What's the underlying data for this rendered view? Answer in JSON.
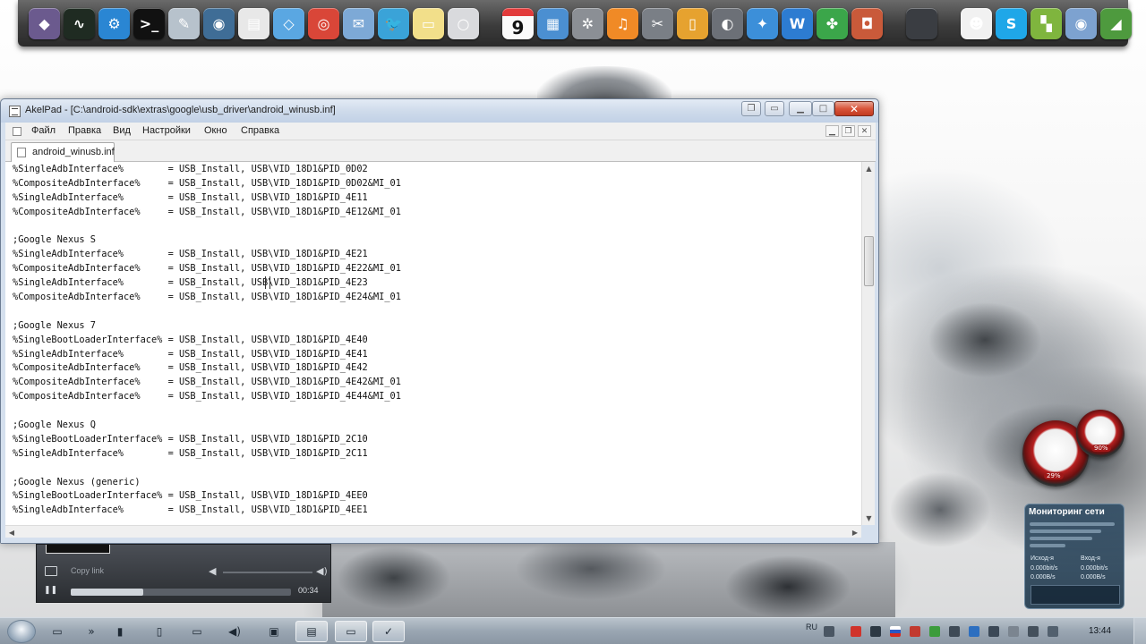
{
  "desktop": {
    "dock_icons": [
      {
        "name": "launchpad-icon",
        "glyph": "◆",
        "color": "#6b5a8e"
      },
      {
        "name": "activity-monitor-icon",
        "glyph": "∿",
        "color": "#1f2b22"
      },
      {
        "name": "system-preferences-icon",
        "glyph": "⚙",
        "color": "#2a86d3"
      },
      {
        "name": "terminal-icon",
        "glyph": ">_",
        "color": "#111111"
      },
      {
        "name": "textedit-icon",
        "glyph": "✎",
        "color": "#b7c2cc"
      },
      {
        "name": "disk-utility-icon",
        "glyph": "◉",
        "color": "#3f6d96"
      },
      {
        "name": "notepad-icon",
        "glyph": "▤",
        "color": "#e8e8e8"
      },
      {
        "name": "dropbox-icon",
        "glyph": "◇",
        "color": "#5aa7e2"
      },
      {
        "name": "chrome-icon",
        "glyph": "◎",
        "color": "#d94638"
      },
      {
        "name": "mail-icon",
        "glyph": "✉",
        "color": "#7da9d6"
      },
      {
        "name": "twitter-icon",
        "glyph": "🐦",
        "color": "#3aa3d8"
      },
      {
        "name": "notes-icon",
        "glyph": "▭",
        "color": "#f2df8a"
      },
      {
        "name": "finder-icon",
        "glyph": "○",
        "color": "#d9dadd"
      },
      {
        "name": "calendar-icon",
        "glyph": "9",
        "color": "#ffffff"
      },
      {
        "name": "preview-icon",
        "glyph": "▦",
        "color": "#4b8fd1"
      },
      {
        "name": "network-icon",
        "glyph": "✲",
        "color": "#8b8f95"
      },
      {
        "name": "itunes-icon",
        "glyph": "♫",
        "color": "#f08a26"
      },
      {
        "name": "photo-tool-icon",
        "glyph": "✂",
        "color": "#7a7f86"
      },
      {
        "name": "ibooks-icon",
        "glyph": "▯",
        "color": "#e6a22f"
      },
      {
        "name": "sysmon-icon",
        "glyph": "◐",
        "color": "#6c7077"
      },
      {
        "name": "safari-icon",
        "glyph": "✦",
        "color": "#3c8fd9"
      },
      {
        "name": "wunderlist-icon",
        "glyph": "W",
        "color": "#2d7cd1"
      },
      {
        "name": "evernote-icon",
        "glyph": "✤",
        "color": "#3ba64a"
      },
      {
        "name": "photobooth-icon",
        "glyph": "◘",
        "color": "#c95a3a"
      },
      {
        "name": "blank-app-icon",
        "glyph": "",
        "color": "#3a3d42"
      },
      {
        "name": "contacts-icon",
        "glyph": "☻",
        "color": "#f1f1f1"
      },
      {
        "name": "skype-icon",
        "glyph": "S",
        "color": "#1fa7e8"
      },
      {
        "name": "microsoft-icon",
        "glyph": "▚",
        "color": "#7fb53e"
      },
      {
        "name": "browser-icon",
        "glyph": "◉",
        "color": "#7da2d0"
      },
      {
        "name": "grapher-icon",
        "glyph": "◢",
        "color": "#4e9a3e"
      }
    ]
  },
  "window": {
    "title": "AkelPad - [C:\\android-sdk\\extras\\google\\usb_driver\\android_winusb.inf]",
    "menu": [
      "Файл",
      "Правка",
      "Вид",
      "Настройки",
      "Окно",
      "Справка"
    ],
    "tab_label": "android_winusb.inf",
    "lines": [
      "%SingleAdbInterface%        = USB_Install, USB\\VID_18D1&PID_0D02",
      "%CompositeAdbInterface%     = USB_Install, USB\\VID_18D1&PID_0D02&MI_01",
      "%SingleAdbInterface%        = USB_Install, USB\\VID_18D1&PID_4E11",
      "%CompositeAdbInterface%     = USB_Install, USB\\VID_18D1&PID_4E12&MI_01",
      "",
      ";Google Nexus S",
      "%SingleAdbInterface%        = USB_Install, USB\\VID_18D1&PID_4E21",
      "%CompositeAdbInterface%     = USB_Install, USB\\VID_18D1&PID_4E22&MI_01",
      "%SingleAdbInterface%        = USB_Install, USB\\VID_18D1&PID_4E23",
      "%CompositeAdbInterface%     = USB_Install, USB\\VID_18D1&PID_4E24&MI_01",
      "",
      ";Google Nexus 7",
      "%SingleBootLoaderInterface% = USB_Install, USB\\VID_18D1&PID_4E40",
      "%SingleAdbInterface%        = USB_Install, USB\\VID_18D1&PID_4E41",
      "%CompositeAdbInterface%     = USB_Install, USB\\VID_18D1&PID_4E42",
      "%CompositeAdbInterface%     = USB_Install, USB\\VID_18D1&PID_4E42&MI_01",
      "%CompositeAdbInterface%     = USB_Install, USB\\VID_18D1&PID_4E44&MI_01",
      "",
      ";Google Nexus Q",
      "%SingleBootLoaderInterface% = USB_Install, USB\\VID_18D1&PID_2C10",
      "%SingleAdbInterface%        = USB_Install, USB\\VID_18D1&PID_2C11",
      "",
      ";Google Nexus (generic)",
      "%SingleBootLoaderInterface% = USB_Install, USB\\VID_18D1&PID_4EE0",
      "%SingleAdbInterface%        = USB_Install, USB\\VID_18D1&PID_4EE1"
    ]
  },
  "media_player": {
    "copy_label": "Copy link",
    "time": "00:34",
    "progress_fraction": 0.33
  },
  "gadgets": {
    "cpu_value": "29%",
    "ram_value": "90%",
    "net_title": "Мониторинг сети",
    "out_label": "Исход-я",
    "in_label": "Вход-я",
    "out_rate": "0.000bit/s",
    "in_rate": "0.000bit/s",
    "out_rate2": "0.000B/s",
    "in_rate2": "0.000B/s"
  },
  "taskbar": {
    "lang": "RU",
    "clock": "13:44"
  }
}
